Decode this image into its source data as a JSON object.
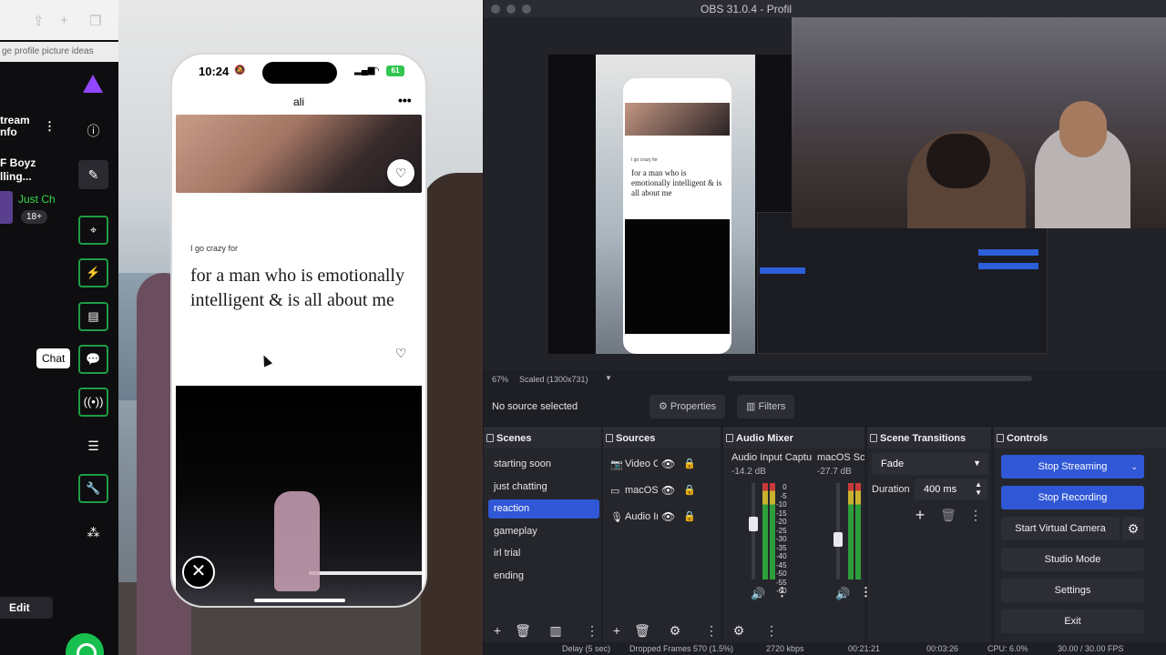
{
  "left_panel": {
    "tab_title": "ge profile picture ideas",
    "stream_info": "tream\nnfo",
    "stream_title": "F Boyz\nlling...",
    "category": "Just Ch",
    "tag": "18+",
    "chat_tooltip": "Chat",
    "edit_label": "Edit",
    "sidebar_icons": [
      "logo-icon",
      "info-icon",
      "pencil-icon",
      "capture-icon",
      "lightning-icon",
      "notes-icon",
      "chat-icon",
      "broadcast-icon",
      "layout-icon",
      "wrench-icon",
      "share-icon"
    ]
  },
  "phone": {
    "time": "10:24",
    "battery": "61",
    "profile_name": "ali",
    "more": "•••",
    "prompt_question": "I go crazy for",
    "prompt_answer": "for a man who is emotionally intelligent & is all about me",
    "like_glyph": "♡",
    "close_glyph": "✕"
  },
  "obs": {
    "window_title": "OBS 31.0.4 - Profil",
    "mini_text": "for a man who is emotionally intelligent & is all about me",
    "mini_prompt": "I go crazy for",
    "zoom": "67%",
    "scale": "Scaled (1300x731)",
    "no_source": "No source selected",
    "properties_label": "Properties",
    "filters_label": "Filters",
    "docks": {
      "scenes": "Scenes",
      "sources": "Sources",
      "audio_mixer": "Audio Mixer",
      "scene_transitions": "Scene Transitions",
      "controls": "Controls"
    },
    "scenes": [
      {
        "label": "starting soon",
        "active": false
      },
      {
        "label": "just chatting",
        "active": false
      },
      {
        "label": "reaction",
        "active": true
      },
      {
        "label": "gameplay",
        "active": false
      },
      {
        "label": "irl trial",
        "active": false
      },
      {
        "label": "ending",
        "active": false
      }
    ],
    "sources": [
      {
        "label": "Video C",
        "icon": "camera-icon"
      },
      {
        "label": "macOS",
        "icon": "display-icon"
      },
      {
        "label": "Audio Ir",
        "icon": "mic-icon"
      }
    ],
    "mixer": [
      {
        "name": "Audio Input Captu",
        "db": "-14.2 dB",
        "level": 0.78
      },
      {
        "name": "macOS Scre",
        "db": "-27.7 dB",
        "level": 0.62
      }
    ],
    "mixer_scale": [
      "0",
      "-5",
      "-10",
      "-15",
      "-20",
      "-25",
      "-30",
      "-35",
      "-40",
      "-45",
      "-50",
      "-55",
      "-60"
    ],
    "transition": {
      "selected": "Fade",
      "duration_label": "Duration",
      "duration_value": "400 ms"
    },
    "controls": {
      "stop_streaming": "Stop Streaming",
      "stop_recording": "Stop Recording",
      "start_virtual_camera": "Start Virtual Camera",
      "studio_mode": "Studio Mode",
      "settings": "Settings",
      "exit": "Exit"
    },
    "statusbar": {
      "delay": "Delay (5 sec)",
      "dropped": "Dropped Frames 570 (1.5%)",
      "bitrate": "2720 kbps",
      "stream_time": "00:21:21",
      "rec_time": "00:03:26",
      "cpu": "CPU: 6.0%",
      "fps": "30.00 / 30.00 FPS"
    }
  },
  "colors": {
    "obs_accent": "#2f57d6",
    "twitch_green": "#1f9d44",
    "twitch_purple": "#9146ff"
  }
}
